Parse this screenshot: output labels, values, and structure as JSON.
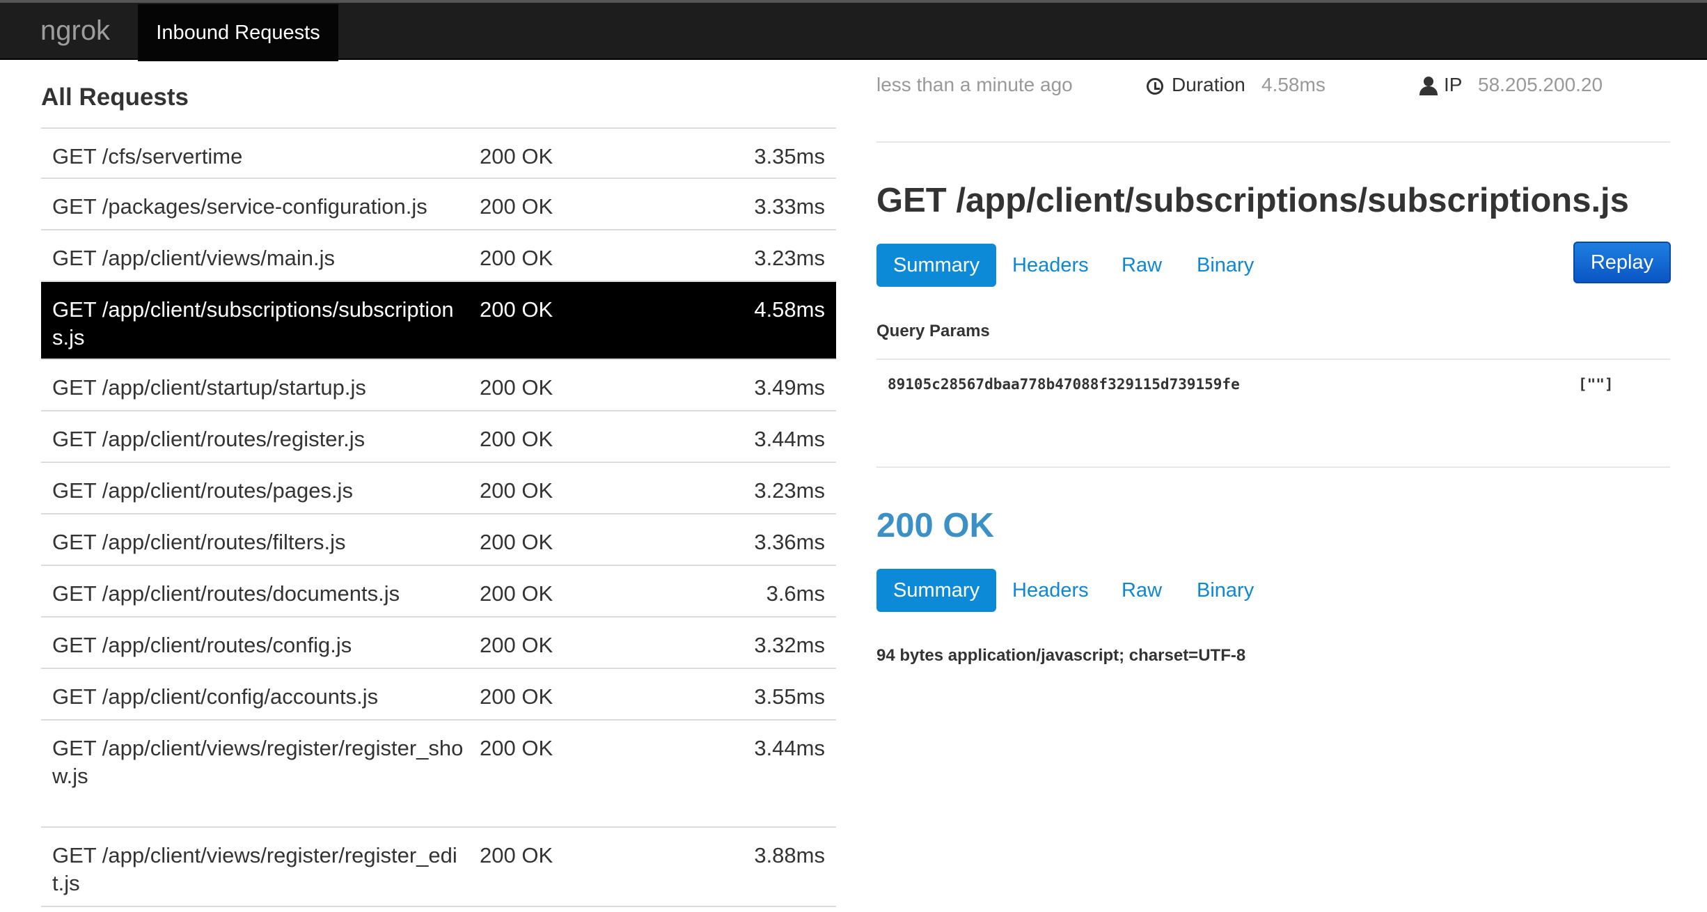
{
  "navbar": {
    "brand": "ngrok",
    "tab_label": "Inbound Requests"
  },
  "requests_panel": {
    "title": "All Requests",
    "rows": [
      {
        "path": "GET /cfs/servertime",
        "status": "200 OK",
        "duration": "3.35ms",
        "selected": false
      },
      {
        "path": "GET /packages/service-configuration.js",
        "status": "200 OK",
        "duration": "3.33ms",
        "selected": false
      },
      {
        "path": "GET /app/client/views/main.js",
        "status": "200 OK",
        "duration": "3.23ms",
        "selected": false
      },
      {
        "path": "GET /app/client/subscriptions/subscriptions.js",
        "status": "200 OK",
        "duration": "4.58ms",
        "selected": true
      },
      {
        "path": "GET /app/client/startup/startup.js",
        "status": "200 OK",
        "duration": "3.49ms",
        "selected": false
      },
      {
        "path": "GET /app/client/routes/register.js",
        "status": "200 OK",
        "duration": "3.44ms",
        "selected": false
      },
      {
        "path": "GET /app/client/routes/pages.js",
        "status": "200 OK",
        "duration": "3.23ms",
        "selected": false
      },
      {
        "path": "GET /app/client/routes/filters.js",
        "status": "200 OK",
        "duration": "3.36ms",
        "selected": false
      },
      {
        "path": "GET /app/client/routes/documents.js",
        "status": "200 OK",
        "duration": "3.6ms",
        "selected": false
      },
      {
        "path": "GET /app/client/routes/config.js",
        "status": "200 OK",
        "duration": "3.32ms",
        "selected": false
      },
      {
        "path": "GET /app/client/config/accounts.js",
        "status": "200 OK",
        "duration": "3.55ms",
        "selected": false
      },
      {
        "path": "GET /app/client/views/register/register_show.js",
        "status": "200 OK",
        "duration": "3.44ms",
        "selected": false
      },
      {
        "path": "GET /app/client/views/register/register_edit.js",
        "status": "200 OK",
        "duration": "3.88ms",
        "selected": false
      }
    ]
  },
  "detail": {
    "time_ago": "less than a minute ago",
    "duration_label": "Duration",
    "duration_value": "4.58ms",
    "ip_label": "IP",
    "ip_value": "58.205.200.20",
    "request_title": "GET /app/client/subscriptions/subscriptions.js",
    "request_tabs": [
      "Summary",
      "Headers",
      "Raw",
      "Binary"
    ],
    "replay_label": "Replay",
    "query_params_label": "Query Params",
    "query_param_key": "89105c28567dbaa778b47088f329115d739159fe",
    "query_param_value": "[\"\"]",
    "response_title": "200 OK",
    "response_tabs": [
      "Summary",
      "Headers",
      "Raw",
      "Binary"
    ],
    "response_summary": "94 bytes application/javascript; charset=UTF-8"
  },
  "colors": {
    "navbar_bg": "#1d1d1d",
    "selected_row_bg": "#000000",
    "accent_blue": "#0c8ad8",
    "link_blue": "#0d87d6",
    "response_status_color": "#3b90c5"
  },
  "icons": {
    "duration": "clock-icon",
    "ip": "user-icon"
  }
}
